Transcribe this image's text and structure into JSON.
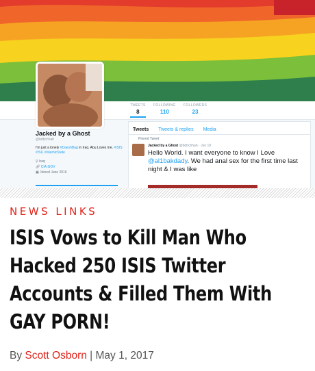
{
  "profile": {
    "stats": [
      {
        "label": "TWEETS",
        "value": "8"
      },
      {
        "label": "FOLLOWING",
        "value": "110"
      },
      {
        "label": "FOLLOWERS",
        "value": "23"
      }
    ],
    "name": "Jacked by a Ghost",
    "handle": "@bdbchhah",
    "bio_prefix": "I'm just a lonely ",
    "bio_hashtag1": "#DaeshBag",
    "bio_middle": " in Iraq. Abu Loves me. ",
    "bio_hashtags": "#ISIS #ISIL #IslamicState",
    "location": "Iraq",
    "link": "CIA.GOV",
    "joined": "Joined June 2016"
  },
  "feed": {
    "tabs": [
      "Tweets",
      "Tweets & replies",
      "Media"
    ],
    "pinned_label": "Pinned Tweet",
    "tweet_author": "Jacked by a Ghost",
    "tweet_handle_date": "@bdbchhah · Jun 18",
    "tweet_text_1": "Hello World. I want everyone to know I Love ",
    "tweet_mention": "@al1bakdady",
    "tweet_text_2": ". We had anal sex for the first time last night & I was like"
  },
  "article": {
    "category": "NEWS LINKS",
    "headline": "ISIS Vows to Kill Man Who Hacked 250 ISIS Twitter Accounts & Filled Them With GAY PORN!",
    "by_prefix": "By ",
    "author": "Scott Osborn",
    "separator": " | ",
    "date": "May 1, 2017"
  },
  "colors": {
    "accent": "#e2231a",
    "twitter_blue": "#1da1f2"
  }
}
